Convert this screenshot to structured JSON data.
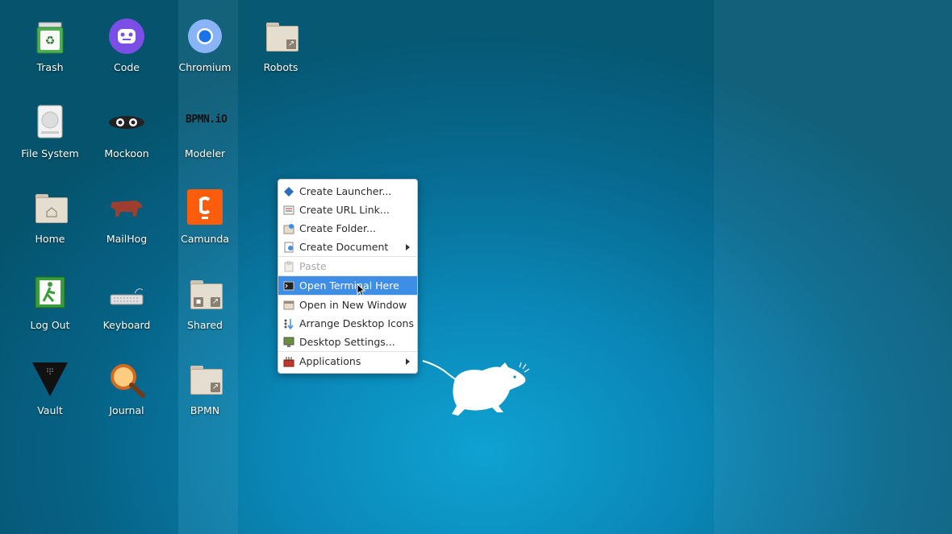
{
  "desktop_icons": {
    "trash": "Trash",
    "code": "Code",
    "chromium": "Chromium",
    "robots": "Robots",
    "file_system": "File System",
    "mockoon": "Mockoon",
    "modeler": "Modeler",
    "modeler_logo_text": "BPMN.iO",
    "home": "Home",
    "mailhog": "MailHog",
    "camunda": "Camunda",
    "log_out": "Log Out",
    "keyboard": "Keyboard",
    "shared": "Shared",
    "vault": "Vault",
    "journal": "Journal",
    "bpmn": "BPMN"
  },
  "context_menu": {
    "items": [
      {
        "label": "Create Launcher...",
        "icon": "launcher-icon"
      },
      {
        "label": "Create URL Link...",
        "icon": "url-link-icon"
      },
      {
        "label": "Create Folder...",
        "icon": "new-folder-icon"
      },
      {
        "label": "Create Document",
        "icon": "new-document-icon",
        "submenu": true
      },
      {
        "label": "Paste",
        "icon": "paste-icon",
        "disabled": true
      },
      {
        "label": "Open Terminal Here",
        "icon": "terminal-icon",
        "highlighted": true
      },
      {
        "label": "Open in New Window",
        "icon": "window-icon"
      },
      {
        "label": "Arrange Desktop Icons",
        "icon": "arrange-icon"
      },
      {
        "label": "Desktop Settings...",
        "icon": "desktop-settings-icon"
      },
      {
        "label": "Applications",
        "icon": "applications-icon",
        "submenu": true
      }
    ]
  },
  "colors": {
    "menu_highlight": "#3f8ee5",
    "camunda": "#fc5d0d",
    "code": "#7b4fe6"
  }
}
